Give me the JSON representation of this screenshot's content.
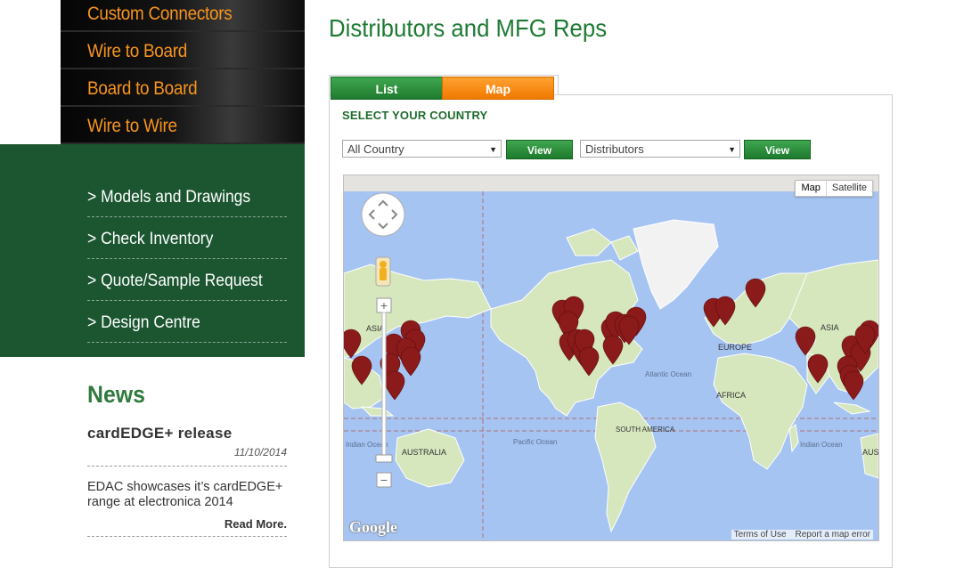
{
  "categories": [
    "Custom Connectors",
    "Wire to Board",
    "Board to Board",
    "Wire to Wire"
  ],
  "quick_links": [
    "> Models and Drawings",
    "> Check Inventory",
    "> Quote/Sample Request",
    "> Design Centre"
  ],
  "news": {
    "title": "News",
    "headline": "cardEDGE+ release",
    "date": "11/10/2014",
    "body": "EDAC showcases it’s cardEDGE+ range at electronica 2014",
    "read_more": "Read More."
  },
  "page_title": "Distributors and MFG Reps",
  "tabs": {
    "list": "List",
    "map": "Map"
  },
  "select_label": "SELECT YOUR COUNTRY",
  "country_select": "All Country",
  "type_select": "Distributors",
  "view_label": "View",
  "map": {
    "type_map": "Map",
    "type_satellite": "Satellite",
    "terms": "Terms of Use",
    "report": "Report a map error",
    "google": "Google",
    "labels": {
      "asia_left": "ASIA",
      "europe": "EUROPE",
      "asia_right": "ASIA",
      "africa": "AFRICA",
      "south_america": "SOUTH AMERICA",
      "australia": "AUSTRALIA",
      "aust": "AUST",
      "indian_ocean_left": "Indian Ocean",
      "indian_ocean_right": "Indian Ocean",
      "atlantic_ocean": "Atlantic Ocean",
      "pacific_ocean": "Pacific Ocean"
    }
  },
  "colors": {
    "accent_green": "#1e7a33",
    "accent_orange": "#f7941d",
    "marker": "#8b1a1a"
  }
}
